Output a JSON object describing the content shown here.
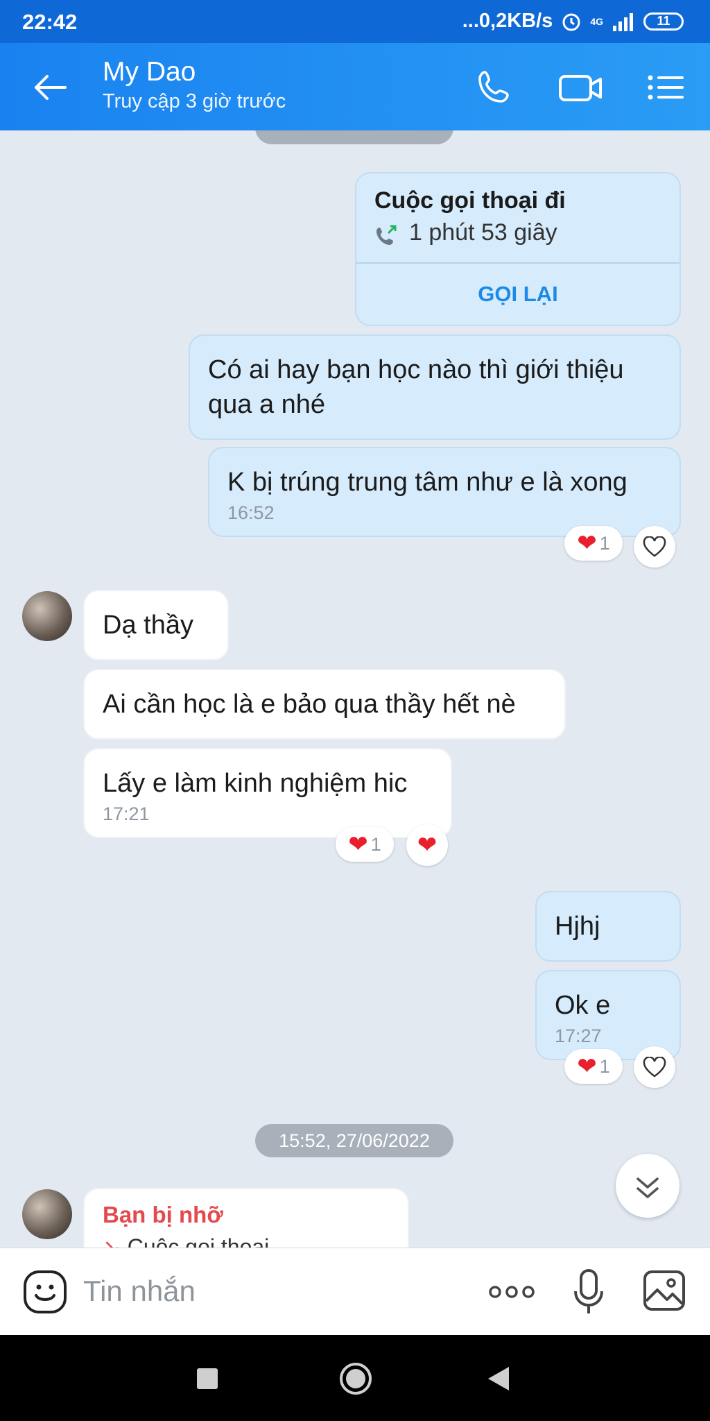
{
  "status_bar": {
    "time": "22:42",
    "network": "...0,2KB/s",
    "signal": "4G",
    "battery": "11"
  },
  "header": {
    "title": "My Dao",
    "subtitle": "Truy cập 3 giờ trước"
  },
  "messages": {
    "call_title": "Cuộc gọi thoại đi",
    "call_duration": "1 phút 53 giây",
    "call_back": "GỌI LẠI",
    "m1": "Có ai hay bạn học nào thì giới thiệu qua a nhé",
    "m2": "K bị trúng trung tâm như e là xong",
    "m2_time": "16:52",
    "m2_react_count": "1",
    "m3": "Dạ thầy",
    "m4": "Ai cần học là e bảo qua thầy hết nè",
    "m5": "Lấy e làm kinh nghiệm hic",
    "m5_time": "17:21",
    "m5_react_count": "1",
    "m6": "Hjhj",
    "m7": "Ok e",
    "m7_time": "17:27",
    "m7_react_count": "1",
    "date_separator": "15:52, 27/06/2022",
    "missed_title": "Bạn bị nhỡ",
    "missed_sub": "Cuộc gọi thoại"
  },
  "composer": {
    "placeholder": "Tin nhắn"
  },
  "colors": {
    "accent": "#1a82f0",
    "out_bubble": "#d6ebfb",
    "heart": "#e8202e",
    "missed": "#e5484d",
    "call_back": "#1a8ae6"
  }
}
